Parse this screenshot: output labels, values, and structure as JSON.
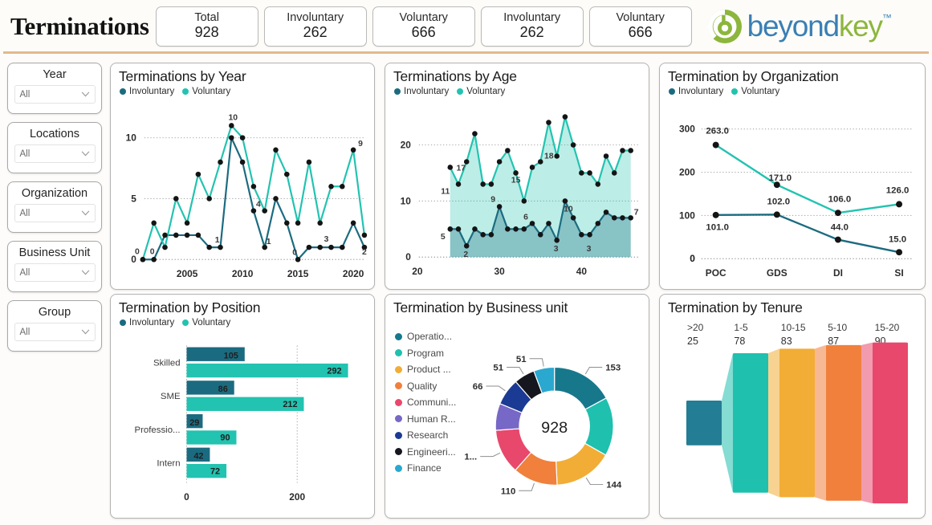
{
  "header": {
    "title": "Terminations",
    "kpis": [
      {
        "label": "Total",
        "value": "928"
      },
      {
        "label": "Involuntary",
        "value": "262"
      },
      {
        "label": "Voluntary",
        "value": "666"
      },
      {
        "label": "Involuntary",
        "value": "262"
      },
      {
        "label": "Voluntary",
        "value": "666"
      }
    ],
    "logo": {
      "part1": "beyond",
      "part2": "key",
      "tm": "™"
    }
  },
  "filters": [
    {
      "title": "Year",
      "value": "All"
    },
    {
      "title": "Locations",
      "value": "All"
    },
    {
      "title": "Organization",
      "value": "All"
    },
    {
      "title": "Business Unit",
      "value": "All"
    },
    {
      "title": "Group",
      "value": "All"
    }
  ],
  "legend": {
    "involuntary": "Involuntary",
    "voluntary": "Voluntary"
  },
  "colors": {
    "involuntary": "#1b6b80",
    "voluntary": "#22c3b0",
    "accent_rule": "#e2b98c",
    "donut": [
      "#17788c",
      "#1fc0ae",
      "#f2ad36",
      "#f0803c",
      "#e8486b",
      "#7767c6",
      "#1b3a93",
      "#16161e",
      "#2aa8d0"
    ],
    "tenure": [
      "#237d95",
      "#1fc0ae",
      "#f2ad36",
      "#f0803c",
      "#e8486b"
    ]
  },
  "charts": {
    "terminations_by_year": {
      "title": "Terminations by Year",
      "chart_data": {
        "type": "line",
        "title": "Terminations by Year",
        "xlabel": "",
        "ylabel": "",
        "x": [
          2001,
          2002,
          2003,
          2004,
          2005,
          2006,
          2007,
          2008,
          2009,
          2010,
          2011,
          2012,
          2013,
          2014,
          2015,
          2016,
          2017,
          2018,
          2019,
          2020,
          2021
        ],
        "tick_labels": [
          "2005",
          "2010",
          "2015",
          "2020"
        ],
        "ylim": [
          0,
          11
        ],
        "yticks": [
          0,
          5,
          10
        ],
        "grid": true,
        "series": [
          {
            "name": "Involuntary",
            "values": [
              0,
              0,
              2,
              2,
              2,
              2,
              1,
              1,
              10,
              8,
              4,
              1,
              5,
              3,
              0,
              1,
              1,
              1,
              1,
              3,
              1
            ]
          },
          {
            "name": "Voluntary",
            "values": [
              0,
              3,
              1,
              5,
              3,
              7,
              5,
              8,
              11,
              10,
              6,
              4,
              9,
              7,
              3,
              8,
              3,
              6,
              6,
              9,
              2
            ]
          }
        ],
        "point_labels": [
          "0",
          "0",
          "1",
          "4",
          "1",
          "0",
          "3",
          "9",
          "10",
          "11"
        ]
      }
    },
    "terminations_by_age": {
      "title": "Terminations by Age",
      "chart_data": {
        "type": "area",
        "title": "Terminations by Age",
        "xlabel": "",
        "ylabel": "",
        "x": [
          24,
          25,
          26,
          27,
          28,
          29,
          30,
          31,
          32,
          33,
          34,
          35,
          36,
          37,
          38,
          39,
          40,
          41,
          42,
          43,
          44,
          45,
          46
        ],
        "tick_labels": [
          "20",
          "30",
          "40"
        ],
        "ylim": [
          0,
          25
        ],
        "yticks": [
          0,
          10,
          20
        ],
        "grid": true,
        "series": [
          {
            "name": "Involuntary",
            "values": [
              5,
              5,
              2,
              5,
              4,
              4,
              9,
              5,
              5,
              5,
              6,
              4,
              6,
              3,
              10,
              7,
              4,
              4,
              6,
              8,
              7,
              7,
              7
            ]
          },
          {
            "name": "Voluntary",
            "values": [
              16,
              13,
              17,
              22,
              13,
              13,
              17,
              19,
              15,
              10,
              16,
              17,
              24,
              18,
              25,
              20,
              15,
              15,
              13,
              18,
              15,
              19,
              19
            ]
          }
        ],
        "point_labels": [
          "5",
          "2",
          "9",
          "11",
          "17",
          "15",
          "6",
          "18",
          "3",
          "10",
          "3",
          "7"
        ]
      }
    },
    "termination_by_organization": {
      "title": "Termination by Organization",
      "chart_data": {
        "type": "line",
        "title": "Termination by Organization",
        "categories": [
          "POC",
          "GDS",
          "DI",
          "SI"
        ],
        "ylim": [
          0,
          320
        ],
        "yticks": [
          0,
          100,
          200,
          300
        ],
        "grid": true,
        "series": [
          {
            "name": "Involuntary",
            "values": [
              101.0,
              102.0,
              44.0,
              15.0
            ],
            "labels": [
              "101.0",
              "102.0",
              "44.0",
              "15.0"
            ]
          },
          {
            "name": "Voluntary",
            "values": [
              263.0,
              171.0,
              106.0,
              126.0
            ],
            "labels": [
              "263.0",
              "171.0",
              "106.0",
              "126.0"
            ]
          }
        ]
      }
    },
    "termination_by_position": {
      "title": "Termination by Position",
      "chart_data": {
        "type": "bar",
        "title": "Termination by Position",
        "orientation": "horizontal",
        "categories": [
          "Skilled",
          "SME",
          "Professio...",
          "Intern"
        ],
        "xticks": [
          0,
          200
        ],
        "xtick_labels": [
          "0",
          "200"
        ],
        "xlim": [
          0,
          310
        ],
        "grid": true,
        "series": [
          {
            "name": "Involuntary",
            "values": [
              105,
              86,
              29,
              42
            ]
          },
          {
            "name": "Voluntary",
            "values": [
              292,
              212,
              90,
              72
            ]
          }
        ]
      }
    },
    "termination_by_business_unit": {
      "title": "Termination by Business unit",
      "center_total": "928",
      "chart_data": {
        "type": "pie",
        "title": "Termination by Business unit",
        "donut": true,
        "center_label": "928",
        "categories": [
          "Operatio...",
          "Program",
          "Product ...",
          "Quality",
          "Communi...",
          "Human R...",
          "Research",
          "Engineeri...",
          "Finance"
        ],
        "values": [
          153,
          144,
          144,
          110,
          110,
          66,
          66,
          51,
          51
        ],
        "labels_shown": [
          "153",
          "144",
          "110",
          "1...",
          "66",
          "51",
          "51"
        ],
        "slices": [
          {
            "name": "Operatio...",
            "value": 153,
            "label": "153"
          },
          {
            "name": "Program",
            "value": 144,
            "label": ""
          },
          {
            "name": "Product ...",
            "value": 144,
            "label": "144"
          },
          {
            "name": "Quality",
            "value": 110,
            "label": "110"
          },
          {
            "name": "Communi...",
            "value": 110,
            "label": "1..."
          },
          {
            "name": "Human R...",
            "value": 66,
            "label": ""
          },
          {
            "name": "Research",
            "value": 66,
            "label": "66"
          },
          {
            "name": "Engineeri...",
            "value": 51,
            "label": "51"
          },
          {
            "name": "Finance",
            "value": 51,
            "label": "51"
          }
        ]
      }
    },
    "termination_by_tenure": {
      "title": "Termination by Tenure",
      "chart_data": {
        "type": "bar",
        "title": "Termination by Tenure",
        "style": "funnel",
        "categories": [
          ">20",
          "1-5",
          "10-15",
          "5-10",
          "15-20"
        ],
        "values": [
          25,
          78,
          83,
          87,
          90
        ],
        "ylim": [
          0,
          90
        ]
      }
    }
  }
}
